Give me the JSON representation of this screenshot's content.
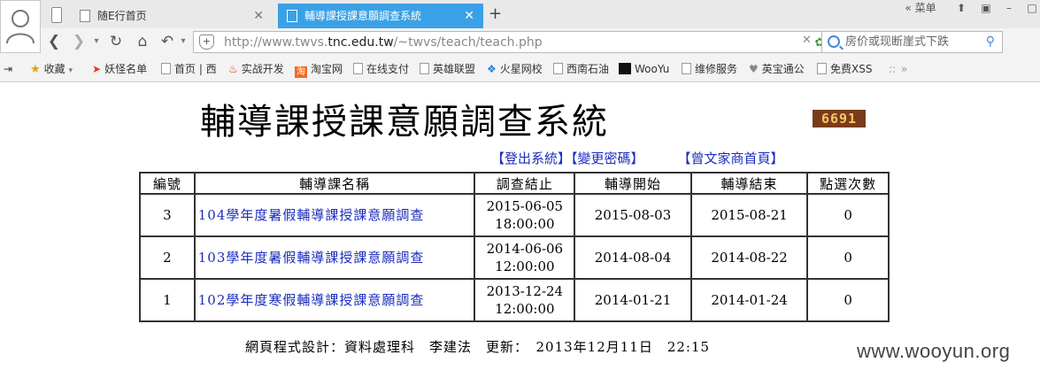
{
  "browser": {
    "tabs": [
      {
        "label": "随E行首页",
        "active": false
      },
      {
        "label": "輔導課授課意願調查系統",
        "active": true
      }
    ],
    "menu_label": "菜单",
    "url_host": "http://www.twvs.",
    "url_domain": "tnc.edu.tw",
    "url_path": "/~twvs/teach/teach.php",
    "search_placeholder": "房价或现断崖式下跌",
    "bookmarks": [
      {
        "label": "收藏",
        "icon": "star-icon"
      },
      {
        "label": "妖怪名单",
        "icon": "arrow-icon"
      },
      {
        "label": "首页 | 西",
        "icon": "page-icon"
      },
      {
        "label": "实战开发",
        "icon": "flame-icon"
      },
      {
        "label": "淘宝网",
        "icon": "taobao-icon"
      },
      {
        "label": "在线支付",
        "icon": "page-icon"
      },
      {
        "label": "英雄联盟",
        "icon": "page-icon"
      },
      {
        "label": "火星网校",
        "icon": "fire-icon"
      },
      {
        "label": "西南石油",
        "icon": "page-icon"
      },
      {
        "label": "WooYu",
        "icon": "wooyun-icon"
      },
      {
        "label": "维修服务",
        "icon": "page-icon"
      },
      {
        "label": "英宝通公",
        "icon": "heart-icon"
      },
      {
        "label": "免费XSS",
        "icon": "page-icon"
      }
    ]
  },
  "page": {
    "title": "輔導課授課意願調查系統",
    "counter": "6691",
    "links": {
      "logout": "【登出系統】",
      "change_password": "【變更密碼】",
      "home": "【曾文家商首頁】"
    },
    "table": {
      "headers": [
        "編號",
        "輔導課名稱",
        "調查結止",
        "輔導開始",
        "輔導結束",
        "點選次數"
      ],
      "rows": [
        {
          "id": "3",
          "name": "104學年度暑假輔導課授課意願調查",
          "end_date": "2015-06-05",
          "end_time": "18:00:00",
          "start": "2015-08-03",
          "finish": "2015-08-21",
          "clicks": "0"
        },
        {
          "id": "2",
          "name": "103學年度暑假輔導課授課意願調查",
          "end_date": "2014-06-06",
          "end_time": "12:00:00",
          "start": "2014-08-04",
          "finish": "2014-08-22",
          "clicks": "0"
        },
        {
          "id": "1",
          "name": "102學年度寒假輔導課授課意願調查",
          "end_date": "2013-12-24",
          "end_time": "12:00:00",
          "start": "2014-01-21",
          "finish": "2014-01-24",
          "clicks": "0"
        }
      ]
    },
    "footer": "網頁程式設計：資料處理科　李建法　更新：　2013年12月11日　22:15"
  },
  "watermark": "www.wooyun.org",
  "colors": {
    "active_tab": "#3aa1e6",
    "link": "#1a2cbd",
    "counter_bg": "#7a3b1d",
    "counter_fg": "#f6c860"
  }
}
